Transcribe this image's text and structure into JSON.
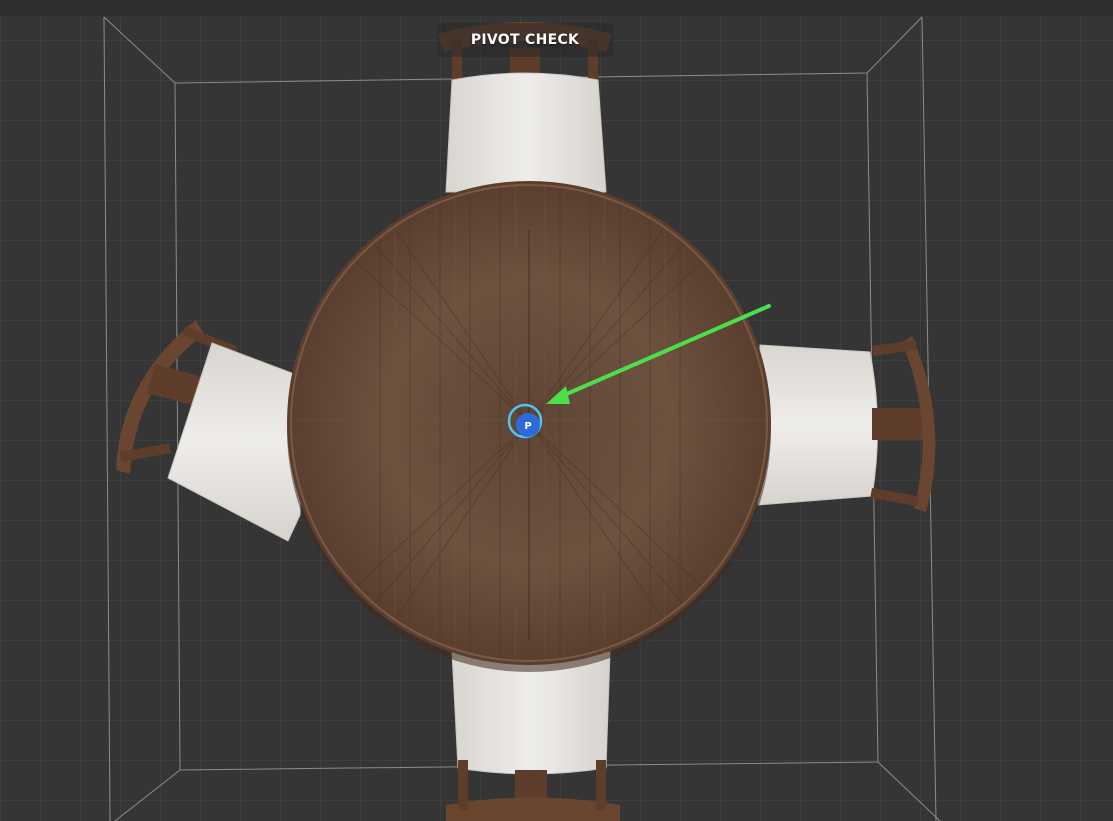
{
  "viewport": {
    "label": "PIVOT CHECK",
    "background": "#353535",
    "grid_color": "#4a4a4a",
    "room_outline_color": "#8a8a8a"
  },
  "scene": {
    "table": {
      "name": "round-dining-table",
      "material": "walnut-wood",
      "color": "#6b4f3a"
    },
    "chairs": [
      {
        "position": "top",
        "seat_color": "#e8e6e2"
      },
      {
        "position": "left",
        "seat_color": "#e8e6e2"
      },
      {
        "position": "right",
        "seat_color": "#e8e6e2"
      },
      {
        "position": "bottom",
        "seat_color": "#e8e6e2"
      }
    ],
    "pivot": {
      "label": "P",
      "fill_color": "#2f6bd8",
      "ring_color": "#4fc3f7"
    },
    "annotation_arrow": {
      "color": "#4be04b"
    }
  }
}
